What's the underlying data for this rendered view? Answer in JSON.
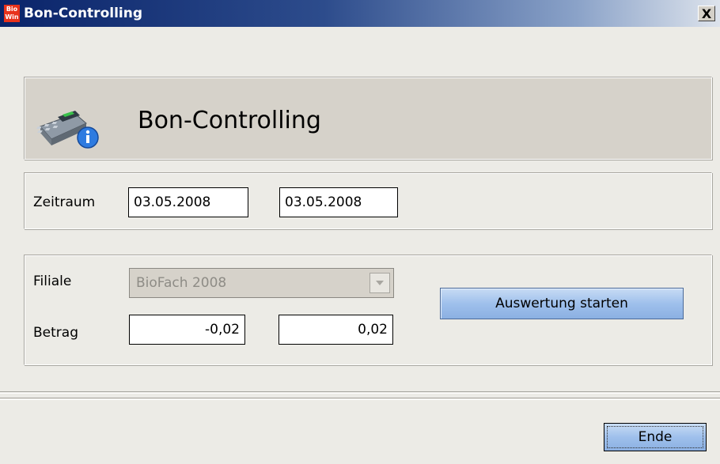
{
  "window": {
    "title": "Bon-Controlling",
    "logo_top": "Bio",
    "logo_bottom": "Win",
    "close_label": "X"
  },
  "header": {
    "title": "Bon-Controlling",
    "icon": "cash-register-info-icon"
  },
  "zeitraum": {
    "label": "Zeitraum",
    "from": "03.05.2008",
    "to": "03.05.2008"
  },
  "filiale": {
    "label": "Filiale",
    "value": "BioFach 2008"
  },
  "betrag": {
    "label": "Betrag",
    "from": "-0,02",
    "to": "0,02"
  },
  "buttons": {
    "start": "Auswertung starten",
    "end": "Ende"
  },
  "colors": {
    "titlebar_start": "#0a246a",
    "button_blue": "#9fc0ec",
    "header_bg": "#d6d2ca"
  }
}
